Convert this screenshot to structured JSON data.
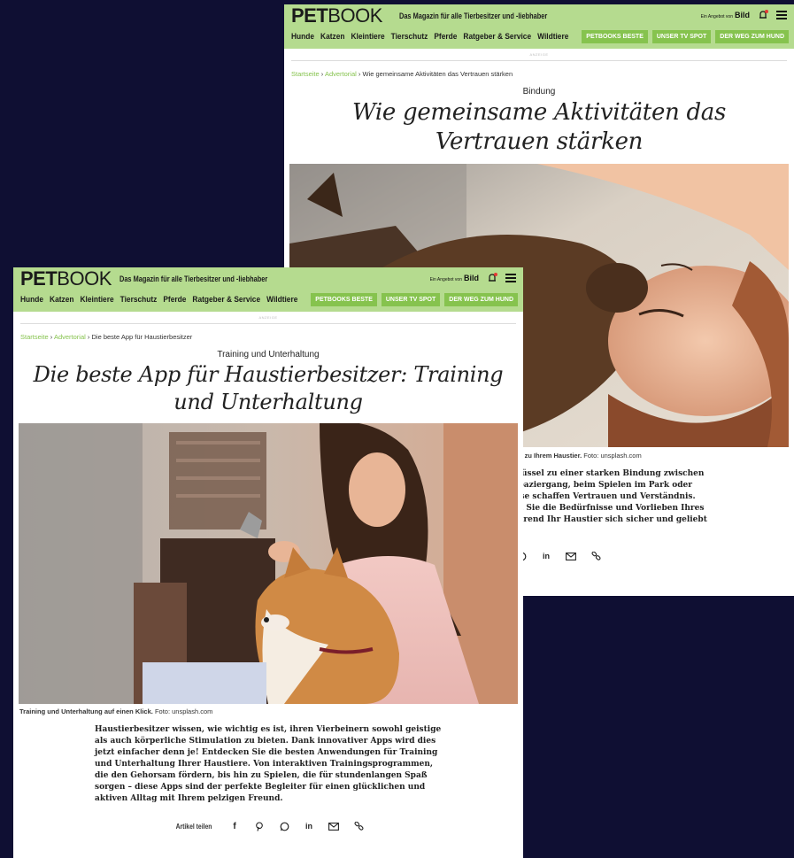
{
  "site": {
    "logo_bold": "PET",
    "logo_light": "BOOK",
    "tagline": "Das Magazin für alle Tierbesitzer und -liebhaber",
    "partner_small": "Ein Angebot von",
    "partner": "Bild",
    "nav": [
      "Hunde",
      "Katzen",
      "Kleintiere",
      "Tierschutz",
      "Pferde",
      "Ratgeber & Service",
      "Wildtiere"
    ],
    "nav_buttons": [
      "PETBOOKS BESTE",
      "UNSER TV SPOT",
      "DER WEG ZUM HUND"
    ],
    "ad_label": "ANZEIGE"
  },
  "back_article": {
    "breadcrumb": [
      "Startseite",
      "Advertorial",
      "Wie gemeinsame Aktivitäten das Vertrauen stärken"
    ],
    "kicker": "Bindung",
    "title": "Wie gemeinsame Aktivitäten das Vertrauen stärken",
    "caption_bold": "… zu Ihrem Haustier.",
    "caption_credit": "Foto: unsplash.com",
    "lead_lines": [
      "hlüssel zu einer starken Bindung zwischen",
      "Spaziergang, beim Spielen im Park oder",
      "isse schaffen Vertrauen und Verständnis.",
      "en Sie die Bedürfnisse und Vorlieben Ihres",
      "ährend Ihr Haustier sich sicher und geliebt"
    ]
  },
  "front_article": {
    "breadcrumb": [
      "Startseite",
      "Advertorial",
      "Die beste App für Haustierbesitzer"
    ],
    "kicker": "Training und Unterhaltung",
    "title": "Die beste App für Haustierbesitzer: Training und Unterhaltung",
    "caption_bold": "Training und Unterhaltung auf einen Klick.",
    "caption_credit": "Foto: unsplash.com",
    "lead": "Haustierbesitzer wissen, wie wichtig es ist, ihren Vierbeinern sowohl geistige als auch körperliche Stimulation zu bieten. Dank innovativer Apps wird dies jetzt einfacher denn je! Entdecken Sie die besten Anwendungen für Training und Unterhaltung Ihrer Haustiere. Von interaktiven Trainingsprogrammen, die den Gehorsam fördern, bis hin zu Spielen, die für stundenlangen Spaß sorgen – diese Apps sind der perfekte Begleiter für einen glücklichen und aktiven Alltag mit Ihrem pelzigen Freund.",
    "share_label": "Artikel teilen"
  },
  "icons": [
    "bell-icon",
    "menu-icon",
    "facebook-icon",
    "pinterest-icon",
    "whatsapp-icon",
    "linkedin-icon",
    "mail-icon",
    "link-icon"
  ],
  "colors": {
    "background": "#0f0f33",
    "header": "#b5db8f",
    "accent": "#86c34e"
  }
}
